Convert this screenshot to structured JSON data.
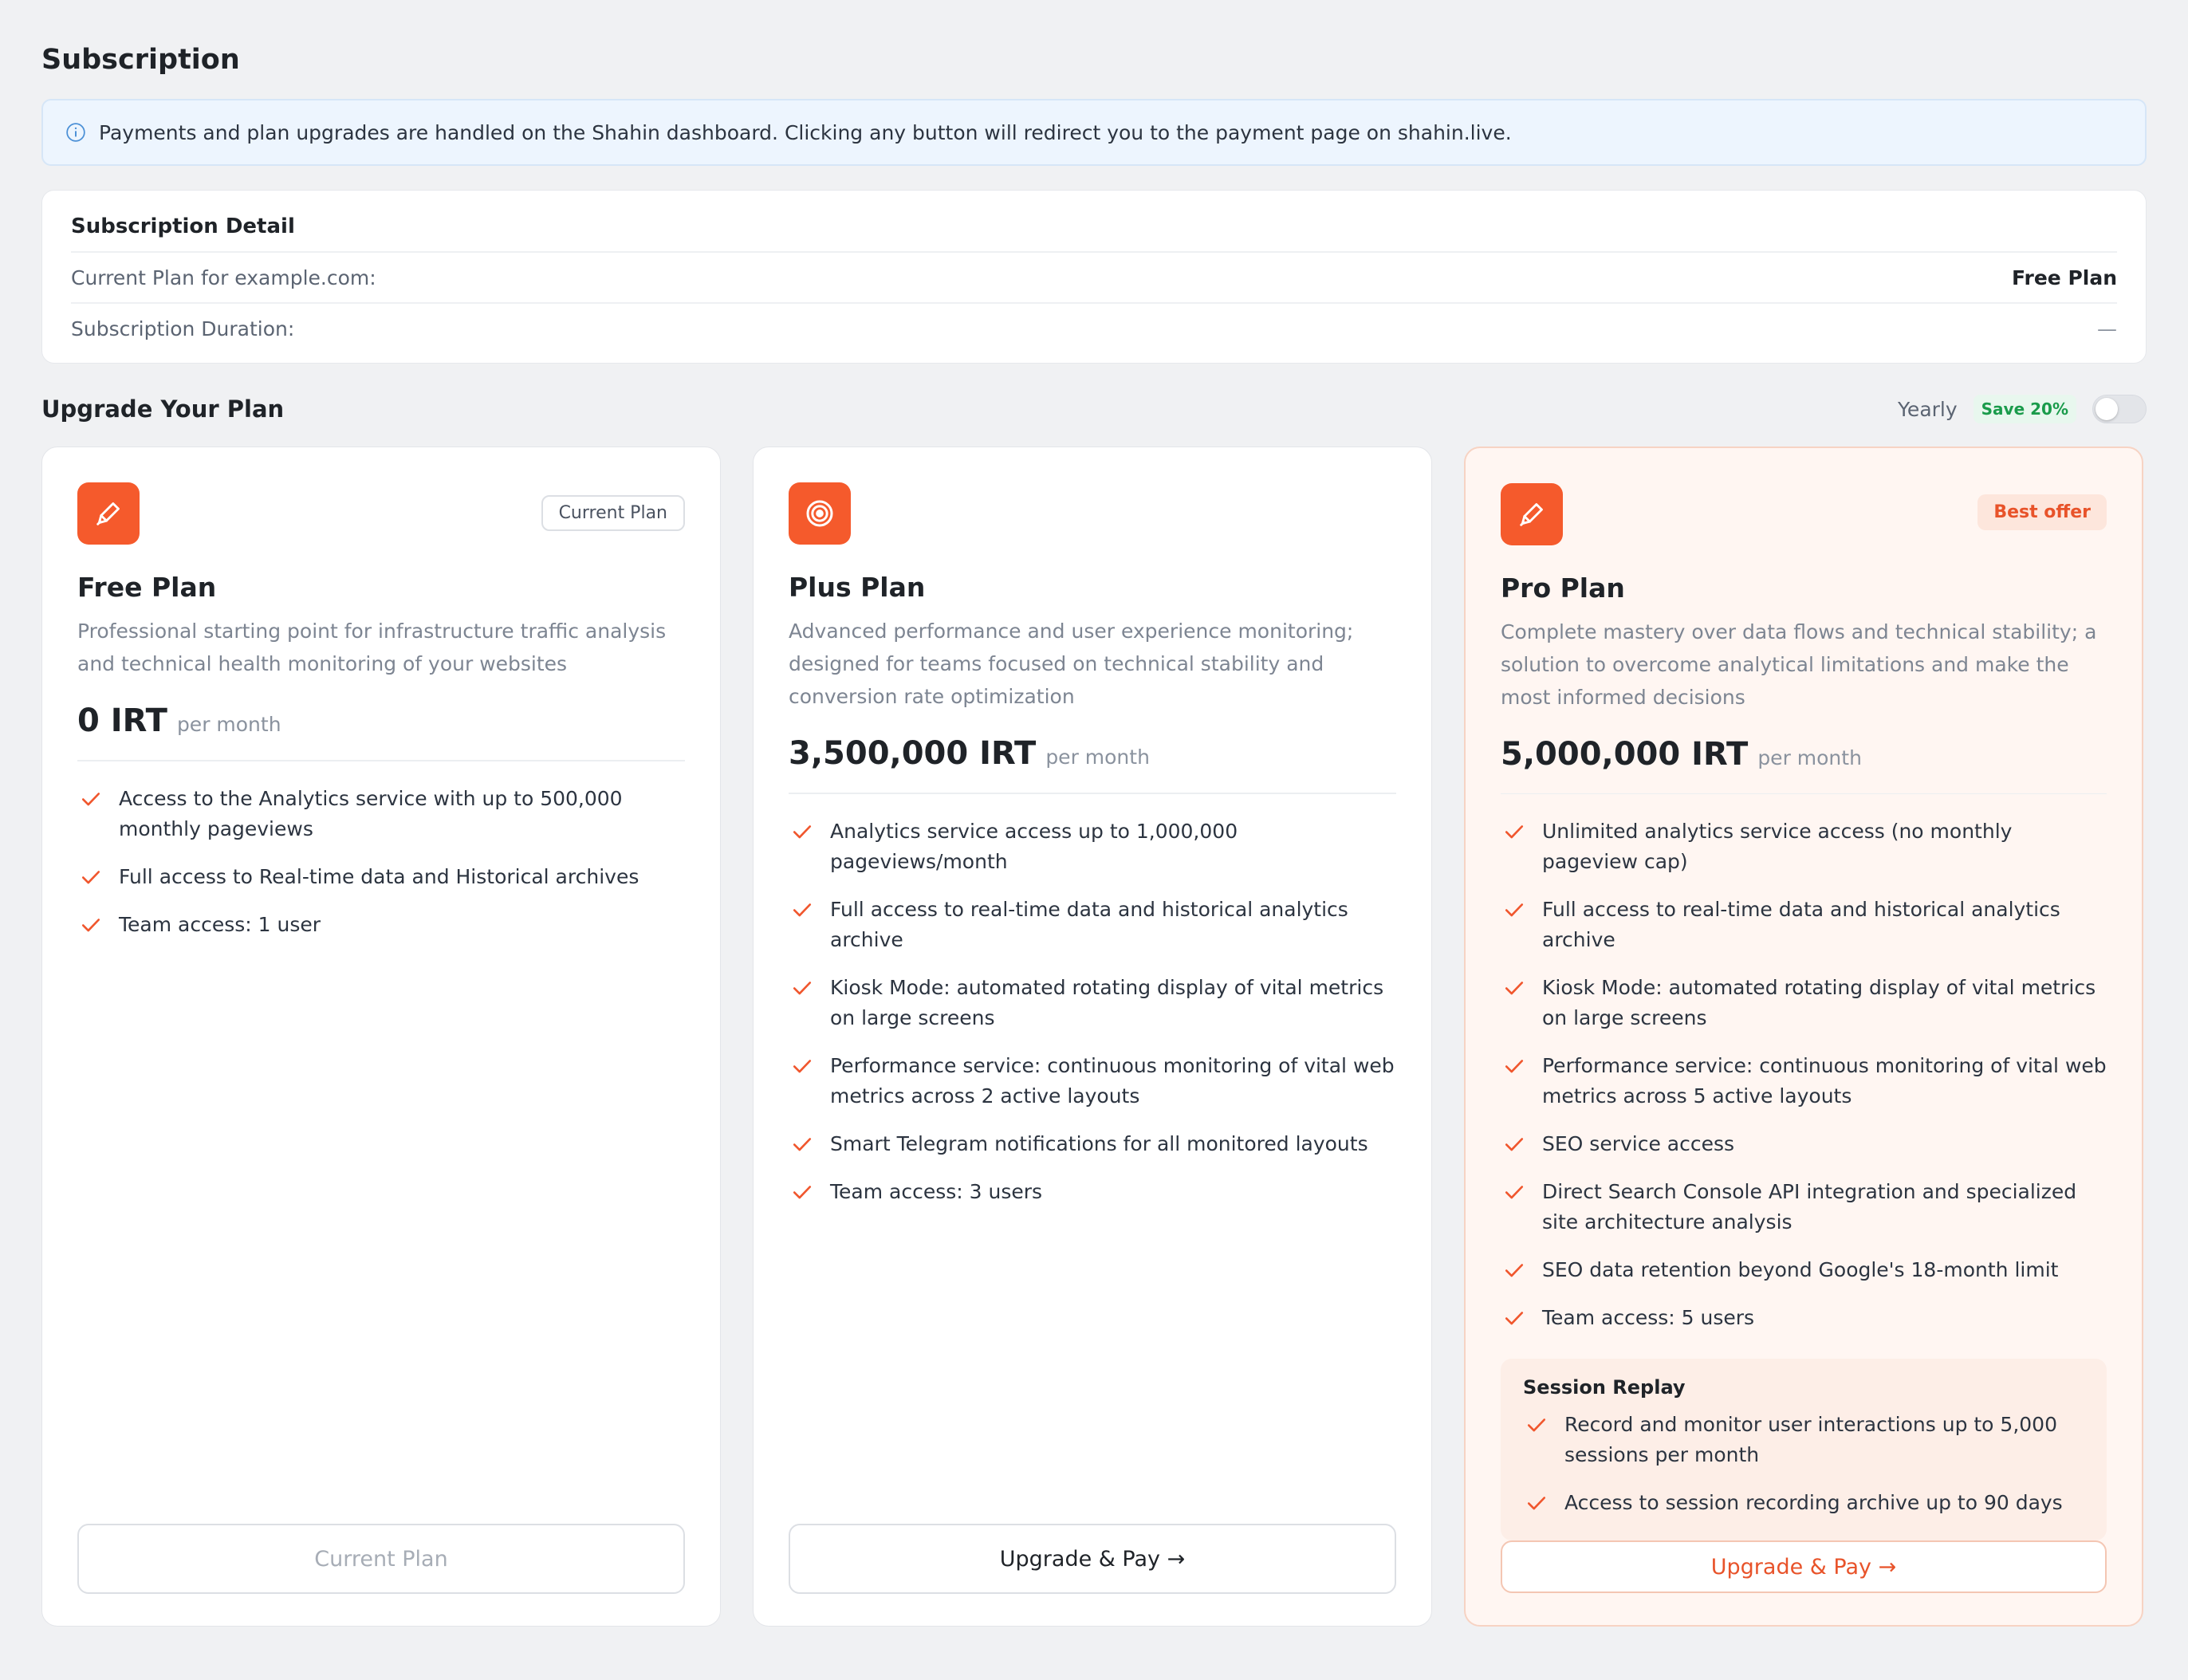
{
  "page": {
    "title": "Subscription"
  },
  "notice": {
    "text": "Payments and plan upgrades are handled on the Shahin dashboard. Clicking any button will redirect you to the payment page on shahin.live."
  },
  "detail": {
    "title": "Subscription Detail",
    "rows": [
      {
        "label": "Current Plan for example.com:",
        "value": "Free Plan"
      },
      {
        "label": "Subscription Duration:",
        "value": "—"
      }
    ]
  },
  "upgrade": {
    "title": "Upgrade Your Plan",
    "billing_label": "Yearly",
    "save_badge": "Save 20%",
    "yearly_enabled": false
  },
  "colors": {
    "accent": "#f55a2c",
    "save_green": "#1a9b4b",
    "info_blue": "#4a8fd6"
  },
  "plans": [
    {
      "icon": "pen-icon",
      "badge": "Current Plan",
      "name": "Free Plan",
      "desc": "Professional starting point for infrastructure traffic analysis and technical health monitoring of your websites",
      "price": "0 IRT",
      "period": "per month",
      "features": [
        "Access to the Analytics service with up to 500,000 monthly pageviews",
        "Full access to Real-time data and Historical archives",
        "Team access: 1 user"
      ],
      "button": "Current Plan"
    },
    {
      "icon": "target-icon",
      "name": "Plus Plan",
      "desc": "Advanced performance and user experience monitoring; designed for teams focused on technical stability and conversion rate optimization",
      "price": "3,500,000 IRT",
      "period": "per month",
      "features": [
        "Analytics service access up to 1,000,000 pageviews/month",
        "Full access to real-time data and historical analytics archive",
        "Kiosk Mode: automated rotating display of vital metrics on large screens",
        "Performance service: continuous monitoring of vital web metrics across 2 active layouts",
        "Smart Telegram notifications for all monitored layouts",
        "Team access: 3 users"
      ],
      "button": "Upgrade & Pay →"
    },
    {
      "icon": "pen-icon",
      "badge": "Best offer",
      "name": "Pro Plan",
      "desc": "Complete mastery over data flows and technical stability; a solution to overcome analytical limitations and make the most informed decisions",
      "price": "5,000,000 IRT",
      "period": "per month",
      "features": [
        "Unlimited analytics service access (no monthly pageview cap)",
        "Full access to real-time data and historical analytics archive",
        "Kiosk Mode: automated rotating display of vital metrics on large screens",
        "Performance service: continuous monitoring of vital web metrics across 5 active layouts",
        "SEO service access",
        "Direct Search Console API integration and specialized site architecture analysis",
        "SEO data retention beyond Google's 18-month limit",
        "Team access: 5 users"
      ],
      "session": {
        "title": "Session Replay",
        "features": [
          "Record and monitor user interactions up to 5,000 sessions per month",
          "Access to session recording archive up to 90 days"
        ]
      },
      "button": "Upgrade & Pay →"
    }
  ]
}
